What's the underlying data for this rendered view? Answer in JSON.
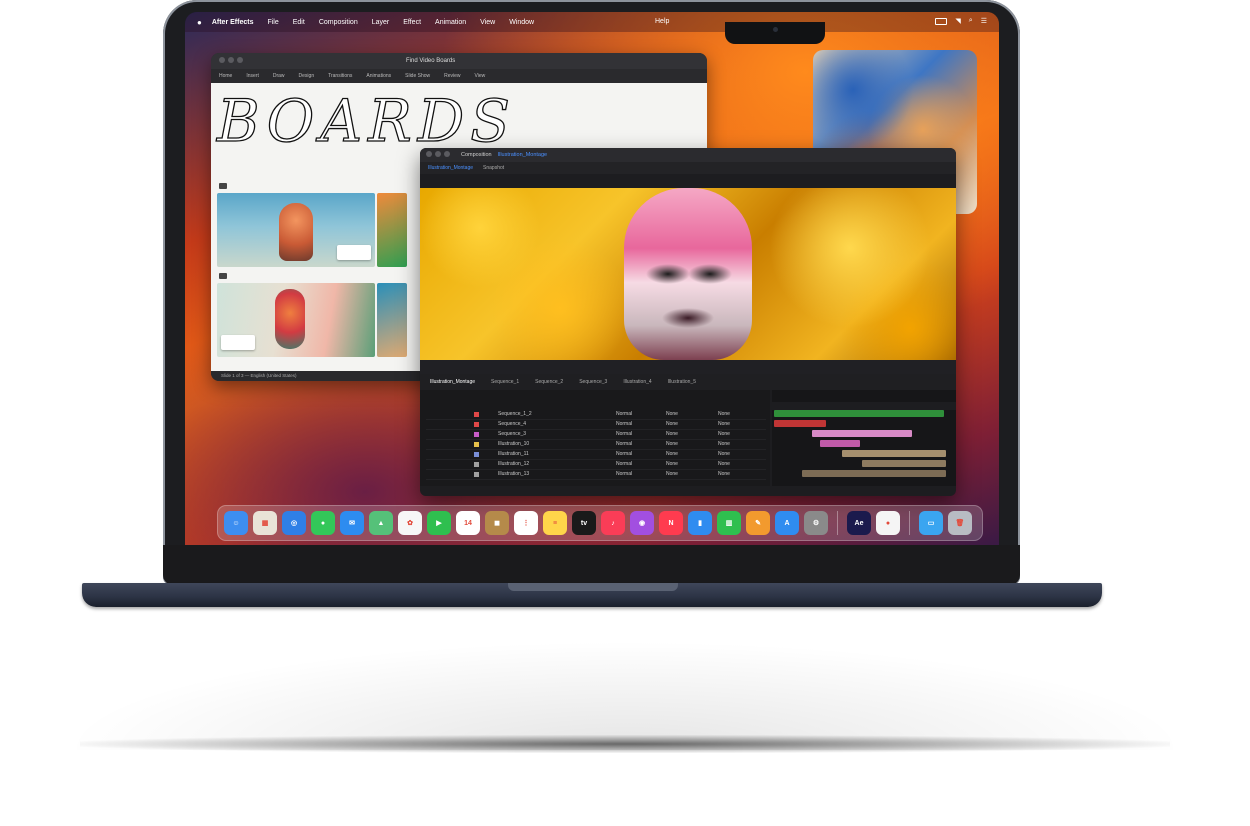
{
  "menubar": {
    "app_name": "After Effects",
    "items": [
      "File",
      "Edit",
      "Composition",
      "Layer",
      "Effect",
      "Animation",
      "View",
      "Window"
    ],
    "help": "Help"
  },
  "browser": {
    "title": "Find Video Boards",
    "tabs": [
      "Home",
      "Insert",
      "Draw",
      "Design",
      "Transitions",
      "Animations",
      "Slide Show",
      "Review",
      "View"
    ],
    "headline": "BOARDS",
    "status": "Slide 1 of 3 — English (United States)"
  },
  "composition": {
    "title": "Composition",
    "comp_name": "Illustration_Montage",
    "tabs": [
      "Illustration_Montage",
      "Snapshot"
    ],
    "timeline_tabs": [
      "Illustration_Montage",
      "Sequence_1",
      "Sequence_2",
      "Sequence_3",
      "Illustration_4",
      "Illustration_5"
    ],
    "layers": [
      {
        "name": "Sequence_1_2",
        "color": "#e04848",
        "mode": "Normal",
        "trkmat": "None",
        "parent": "None"
      },
      {
        "name": "Sequence_4",
        "color": "#e04848",
        "mode": "Normal",
        "trkmat": "None",
        "parent": "None"
      },
      {
        "name": "Sequence_3",
        "color": "#c85cc8",
        "mode": "Normal",
        "trkmat": "None",
        "parent": "None"
      },
      {
        "name": "Illustration_10",
        "color": "#e6c04a",
        "mode": "Normal",
        "trkmat": "None",
        "parent": "None"
      },
      {
        "name": "Illustration_11",
        "color": "#7a8fd8",
        "mode": "Normal",
        "trkmat": "None",
        "parent": "None"
      },
      {
        "name": "Illustration_12",
        "color": "#a0a0a0",
        "mode": "Normal",
        "trkmat": "None",
        "parent": "None"
      },
      {
        "name": "Illustration_13",
        "color": "#a0a0a0",
        "mode": "Normal",
        "trkmat": "None",
        "parent": "None"
      }
    ]
  },
  "dock": {
    "apps": [
      {
        "name": "finder-icon",
        "color": "#3d8ef0",
        "glyph": "☺"
      },
      {
        "name": "launchpad-icon",
        "color": "#e9e3d7",
        "glyph": "▦"
      },
      {
        "name": "safari-icon",
        "color": "#2f7fe6",
        "glyph": "◎"
      },
      {
        "name": "messages-icon",
        "color": "#33c759",
        "glyph": "●"
      },
      {
        "name": "mail-icon",
        "color": "#2d8cf0",
        "glyph": "✉"
      },
      {
        "name": "maps-icon",
        "color": "#55c179",
        "glyph": "▲"
      },
      {
        "name": "photos-icon",
        "color": "#f7f7f7",
        "glyph": "✿"
      },
      {
        "name": "facetime-icon",
        "color": "#2fbf4f",
        "glyph": "▶"
      },
      {
        "name": "calendar-icon",
        "color": "#ffffff",
        "glyph": "14"
      },
      {
        "name": "contacts-icon",
        "color": "#b58a4a",
        "glyph": "◼"
      },
      {
        "name": "reminders-icon",
        "color": "#ffffff",
        "glyph": "⋮"
      },
      {
        "name": "notes-icon",
        "color": "#ffd54a",
        "glyph": "≡"
      },
      {
        "name": "tv-icon",
        "color": "#1a1a1a",
        "glyph": "tv"
      },
      {
        "name": "music-icon",
        "color": "#fa3d57",
        "glyph": "♪"
      },
      {
        "name": "podcasts-icon",
        "color": "#a24fe0",
        "glyph": "◉"
      },
      {
        "name": "news-icon",
        "color": "#ff3b4f",
        "glyph": "N"
      },
      {
        "name": "keynote-icon",
        "color": "#2f8cf0",
        "glyph": "▮"
      },
      {
        "name": "numbers-icon",
        "color": "#2fbf4f",
        "glyph": "▥"
      },
      {
        "name": "pages-icon",
        "color": "#f29a2e",
        "glyph": "✎"
      },
      {
        "name": "app-store-icon",
        "color": "#2f8cf0",
        "glyph": "A"
      },
      {
        "name": "system-settings-icon",
        "color": "#8a8a8a",
        "glyph": "⚙"
      }
    ],
    "extra": [
      {
        "name": "after-effects-icon",
        "color": "#1b1a4d",
        "glyph": "Ae"
      },
      {
        "name": "procreate-icon",
        "color": "#f5f5f5",
        "glyph": "●"
      }
    ],
    "trailing": [
      {
        "name": "downloads-folder-icon",
        "color": "#3aa5f0",
        "glyph": "▭"
      },
      {
        "name": "trash-icon",
        "color": "#b8bcc3",
        "glyph": "🗑"
      }
    ]
  }
}
